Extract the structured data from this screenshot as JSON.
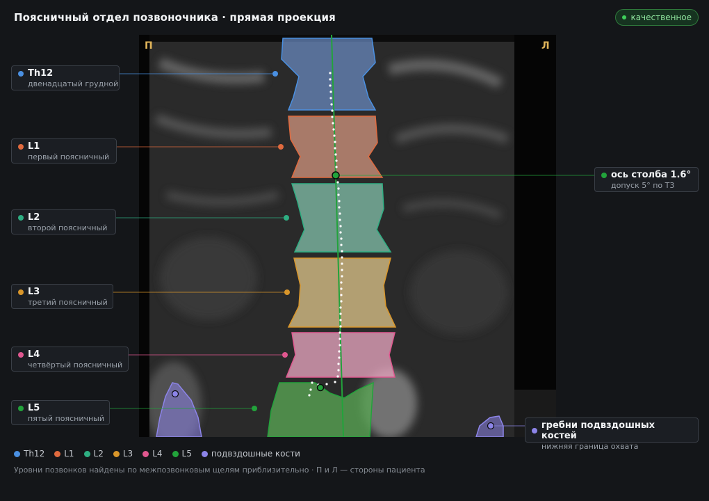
{
  "title": "Поясничный отдел позвоночника · прямая проекция",
  "badge": "качественное",
  "side_right": "П",
  "side_left": "Л",
  "labels": [
    {
      "name": "Th12",
      "sub": "двенадцатый грудной",
      "color": "#4a90e2"
    },
    {
      "name": "L1",
      "sub": "первый поясничный",
      "color": "#e06a3e"
    },
    {
      "name": "L2",
      "sub": "второй поясничный",
      "color": "#2eae82"
    },
    {
      "name": "L3",
      "sub": "третий поясничный",
      "color": "#d9962a"
    },
    {
      "name": "L4",
      "sub": "четвёртый поясничный",
      "color": "#e0578f"
    },
    {
      "name": "L5",
      "sub": "пятый поясничный",
      "color": "#22a33b"
    }
  ],
  "axis": {
    "name": "ось столба 1.6°",
    "sub": "допуск 5° по Т3",
    "color": "#22a33b"
  },
  "iliac": {
    "name": "гребни подвздошных костей",
    "sub": "нижняя граница охвата",
    "color": "#8c84e8"
  },
  "legend": [
    {
      "label": "Th12",
      "color": "#4a90e2"
    },
    {
      "label": "L1",
      "color": "#e06a3e"
    },
    {
      "label": "L2",
      "color": "#2eae82"
    },
    {
      "label": "L3",
      "color": "#d9962a"
    },
    {
      "label": "L4",
      "color": "#e0578f"
    },
    {
      "label": "L5",
      "color": "#22a33b"
    },
    {
      "label": "подвздошные кости",
      "color": "#8c84e8"
    }
  ],
  "footnote": "Уровни позвонков найдены по межпозвонковым щелям приблизительно · П и Л — стороны пациента"
}
